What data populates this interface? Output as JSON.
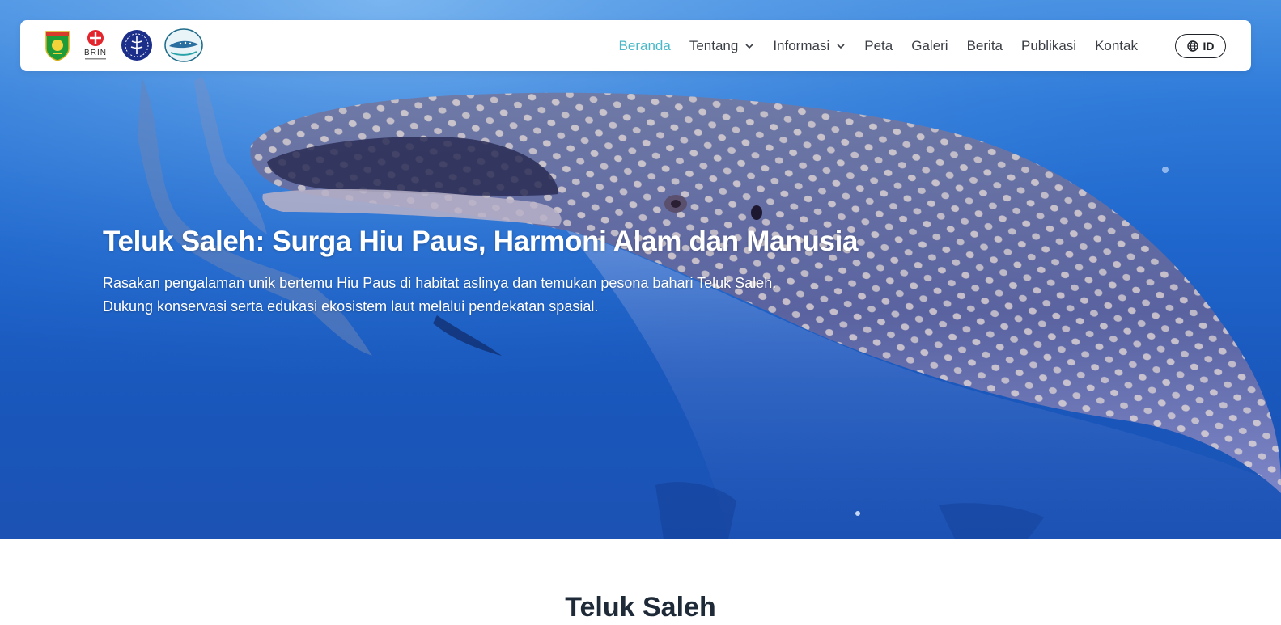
{
  "nav": {
    "logos": [
      {
        "name": "regency-emblem"
      },
      {
        "name": "brin-logo",
        "text": "BRIN"
      },
      {
        "name": "university-seal"
      },
      {
        "name": "teluk-saleh-logo"
      }
    ],
    "menu": [
      {
        "label": "Beranda",
        "active": true,
        "dropdown": false
      },
      {
        "label": "Tentang",
        "active": false,
        "dropdown": true
      },
      {
        "label": "Informasi",
        "active": false,
        "dropdown": true
      },
      {
        "label": "Peta",
        "active": false,
        "dropdown": false
      },
      {
        "label": "Galeri",
        "active": false,
        "dropdown": false
      },
      {
        "label": "Berita",
        "active": false,
        "dropdown": false
      },
      {
        "label": "Publikasi",
        "active": false,
        "dropdown": false
      },
      {
        "label": "Kontak",
        "active": false,
        "dropdown": false
      }
    ],
    "language": {
      "label": "ID",
      "icon": "globe-icon"
    }
  },
  "hero": {
    "title": "Teluk Saleh: Surga Hiu Paus, Harmoni Alam dan Manusia",
    "subtitle_line1": "Rasakan pengalaman unik bertemu Hiu Paus di habitat aslinya dan temukan pesona bahari Teluk Saleh.",
    "subtitle_line2": "Dukung konservasi serta edukasi ekosistem laut melalui pendekatan spasial.",
    "image": "whale-shark-underwater-photo"
  },
  "section": {
    "title": "Teluk Saleh"
  },
  "colors": {
    "accent": "#4ab8c8",
    "nav_text": "#3b3f45",
    "ocean": "#1f66cc",
    "heading": "#1e2a38"
  }
}
